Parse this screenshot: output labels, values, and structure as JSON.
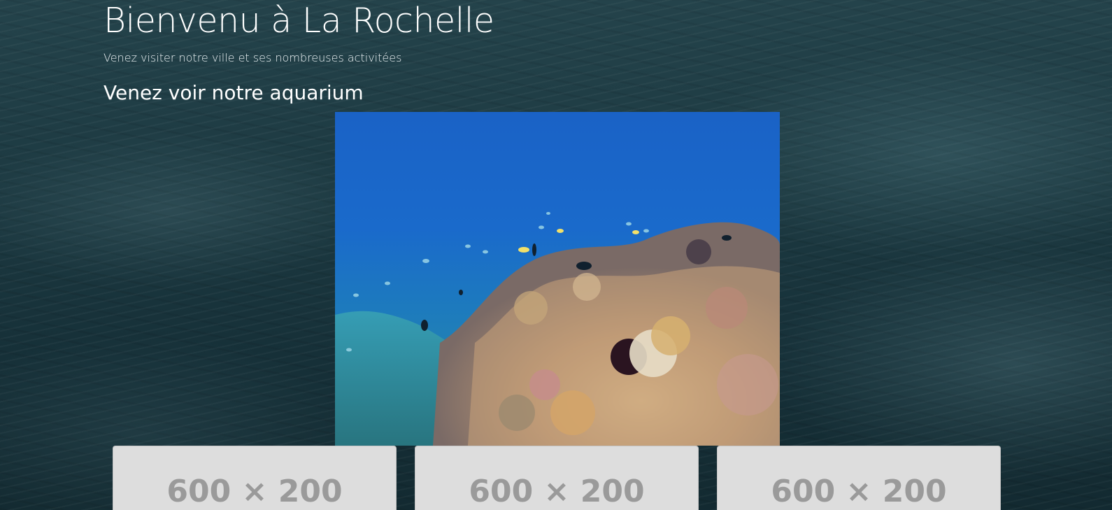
{
  "header": {
    "title": "Bienvenu à La Rochelle",
    "subtitle": "Venez visiter notre ville et ses nombreuses activitées"
  },
  "section": {
    "heading": "Venez voir notre aquarium",
    "image_icon": "coral-reef-photo"
  },
  "cards": [
    {
      "placeholder": "600 × 200"
    },
    {
      "placeholder": "600 × 200"
    },
    {
      "placeholder": "600 × 200"
    }
  ],
  "colors": {
    "background": "#1d3a42",
    "text": "#ffffff",
    "card_bg": "#dddddd",
    "placeholder_text": "#9a9a9a",
    "water": "#1e6fcf"
  }
}
